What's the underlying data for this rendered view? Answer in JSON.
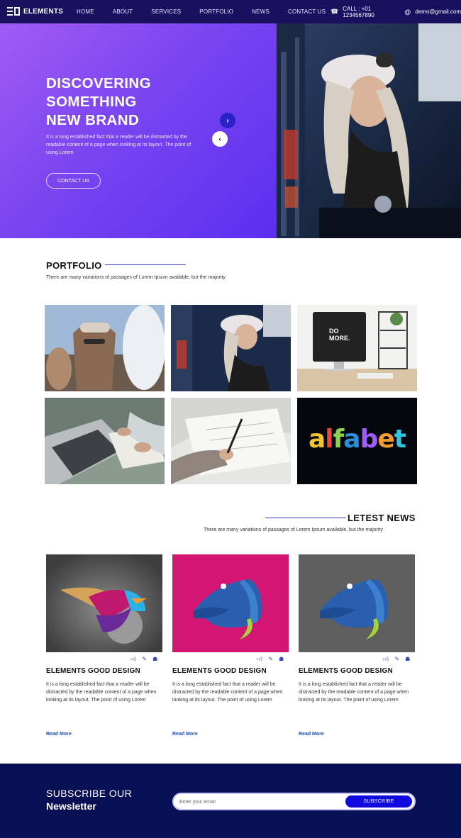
{
  "nav": {
    "brand": "ELEMENTS",
    "items": [
      {
        "label": "HOME"
      },
      {
        "label": "ABOUT"
      },
      {
        "label": "SERVICES"
      },
      {
        "label": "PORTFOLIO"
      },
      {
        "label": "NEWS"
      },
      {
        "label": "CONTACT US"
      }
    ],
    "call": "CALL : +01 1234567890",
    "email": "demo@gmail.com",
    "phone_icon": "phone-icon",
    "email_icon": "at-icon"
  },
  "hero": {
    "title_line1": "DISCOVERING",
    "title_line2": "SOMETHING",
    "title_line3": "NEW BRAND",
    "text": "It is a long established fact that a reader will be distracted by the readable content of a page when looking at its layout. The point of using Lorem",
    "button": "CONTACT US",
    "next_icon": "chevron-right-icon",
    "prev_icon": "chevron-left-icon",
    "gradient_start": "#a05cf5",
    "gradient_end": "#5b2ef0"
  },
  "portfolio": {
    "title": "PORTFOLIO",
    "subtitle": "There are many variations of passages of Lorem Ipsum available, but the majority",
    "tile_text_domore_1": "DO",
    "tile_text_domore_2": "MORE.",
    "tile_text_alfabet": "alfabet"
  },
  "news": {
    "title": "LETEST NEWS",
    "subtitle": "There are many variations of passages of Lorem Ipsum available, but the majority",
    "cards": [
      {
        "title": "ELEMENTS GOOD DESIGN",
        "text": "It is a long established fact that a reader will be distracted by the readable content of a page when looking at its layout. The point of using Lorem",
        "link": "Read More"
      },
      {
        "title": "ELEMENTS GOOD DESIGN",
        "text": "It is a long established fact that a reader will be distracted by the readable content of a page when looking at its layout. The point of using Lorem",
        "link": "Read More"
      },
      {
        "title": "ELEMENTS GOOD DESIGN",
        "text": "It is a long established fact that a reader will be distracted by the readable content of a page when looking at its layout. The point of using Lorem",
        "link": "Read More"
      }
    ],
    "icons": [
      "thumbs-up-icon",
      "comment-icon",
      "share-icon"
    ]
  },
  "subscribe": {
    "line1": "SUBSCRIBE OUR",
    "line2": "Newsletter",
    "placeholder": "Enter your email",
    "button": "SUBSCRIBE"
  },
  "colors": {
    "nav_bg": "#1a1060",
    "accent": "#3b35c8",
    "footer_bg": "#080f52",
    "subscribe_button": "#1208e0",
    "link": "#1e4db8"
  }
}
